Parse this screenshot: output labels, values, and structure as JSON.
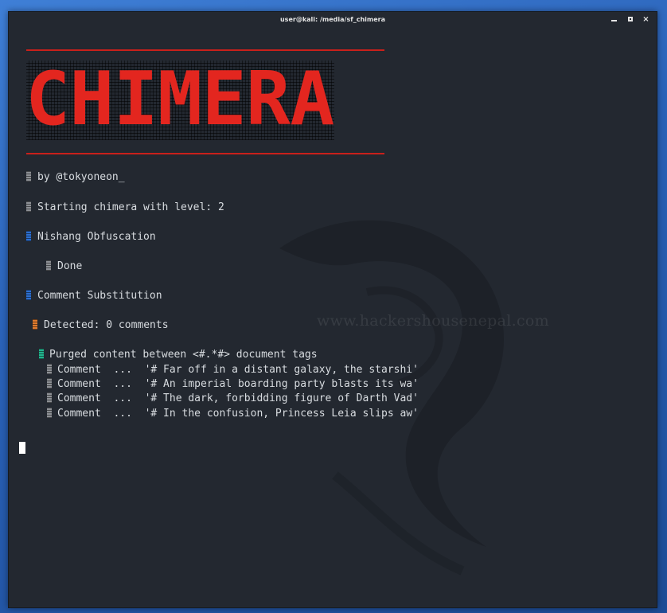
{
  "window": {
    "title": "user@kali: /media/sf_chimera",
    "minimize_label": "_",
    "close_label": "×"
  },
  "banner": {
    "text": "CHIMERA",
    "color": "#e3261f"
  },
  "watermark": "www.hackershousenepal.com",
  "colors": {
    "text": "#d8dce0",
    "marker_gray": "#8d9095",
    "marker_blue": "#2c6fd1",
    "marker_orange": "#e07b2e",
    "marker_green": "#23b58f"
  },
  "terminal_lines": {
    "by": "by @tokyoneon_",
    "starting": "Starting chimera with level: 2",
    "nishang": "Nishang Obfuscation",
    "done": "Done",
    "comment_sub": "Comment Substitution",
    "detected": "Detected: 0 comments",
    "purged": "Purged content between <#.*#> document tags",
    "comments": [
      "Comment  ...  '# Far off in a distant galaxy, the starshi'",
      "Comment  ...  '# An imperial boarding party blasts its wa'",
      "Comment  ...  '# The dark, forbidding figure of Darth Vad'",
      "Comment  ...  '# In the confusion, Princess Leia slips aw'"
    ]
  }
}
